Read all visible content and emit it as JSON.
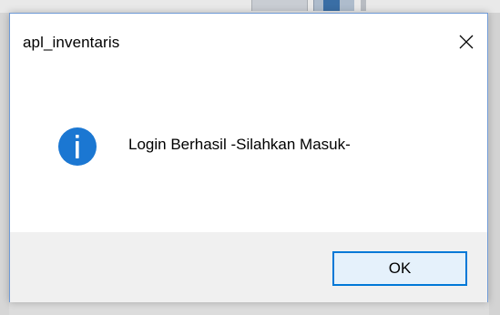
{
  "dialog": {
    "title": "apl_inventaris",
    "close_icon": "close-icon",
    "message_icon": "info-icon",
    "message": "Login Berhasil -Silahkan Masuk-",
    "ok_label": "OK"
  },
  "colors": {
    "info_icon": "#1b77d2",
    "button_border": "#0078d7",
    "button_fill": "#e5f1fb",
    "footer_bg": "#f0f0f0",
    "window_border": "#6f9ad6"
  }
}
